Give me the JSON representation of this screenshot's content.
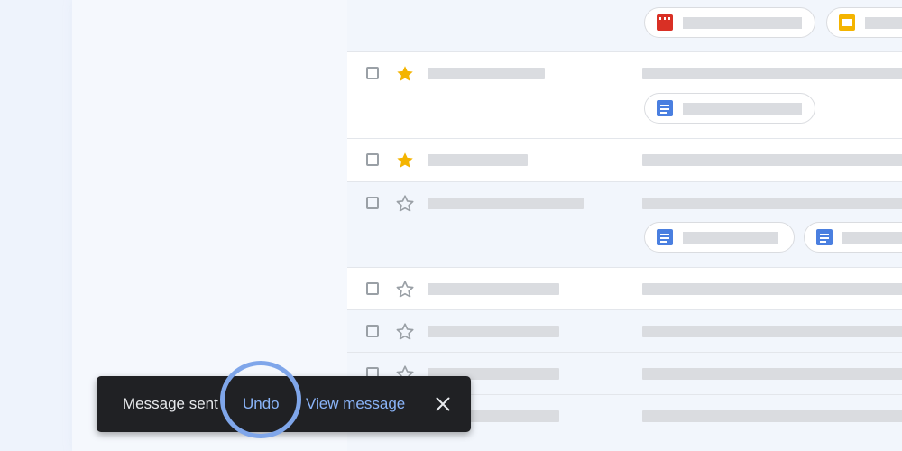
{
  "snackbar": {
    "message": "Message sent",
    "undo_label": "Undo",
    "view_label": "View message",
    "close_icon": "close-icon"
  },
  "email_rows": [
    {
      "starred": null,
      "attachments": [
        "video-file-chip",
        "slides-file-chip"
      ]
    },
    {
      "starred": true,
      "attachments": [
        "doc-file-chip"
      ]
    },
    {
      "starred": true,
      "attachments": []
    },
    {
      "starred": false,
      "attachments": [
        "doc-file-chip",
        "doc-file-chip"
      ]
    },
    {
      "starred": false,
      "attachments": []
    },
    {
      "starred": false,
      "attachments": []
    },
    {
      "starred": false,
      "attachments": []
    },
    {
      "starred": false,
      "attachments": []
    }
  ],
  "colors": {
    "accent_link": "#8ab4f8",
    "star_filled": "#f4b400",
    "highlight_ring": "#7fa6ea",
    "snackbar_bg": "#202124",
    "doc_icon": "#4a7fe0",
    "video_icon": "#d93025",
    "slides_icon": "#f4b400"
  }
}
